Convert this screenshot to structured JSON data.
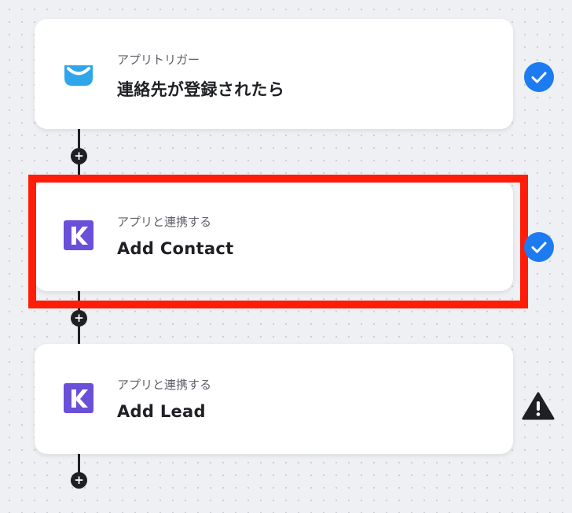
{
  "flow": {
    "steps": [
      {
        "type_label": "アプリトリガー",
        "title": "連絡先が登録されたら",
        "app_icon": "getresponse-envelope-icon",
        "status": "complete"
      },
      {
        "type_label": "アプリと連携する",
        "title": "Add Contact",
        "app_icon": "kommo-k-icon",
        "status": "complete",
        "highlighted": true
      },
      {
        "type_label": "アプリと連携する",
        "title": "Add Lead",
        "app_icon": "kommo-k-icon",
        "status": "warning"
      }
    ],
    "add_button_label": "+"
  },
  "colors": {
    "background": "#eef0f3",
    "card": "#ffffff",
    "connector": "#1f2024",
    "highlight": "#ff1d0a",
    "status_complete": "#1d7bf2",
    "status_warning": "#1f2024",
    "envelope_icon": "#2fa6ea",
    "kommo_icon": "#6a4fd8"
  }
}
